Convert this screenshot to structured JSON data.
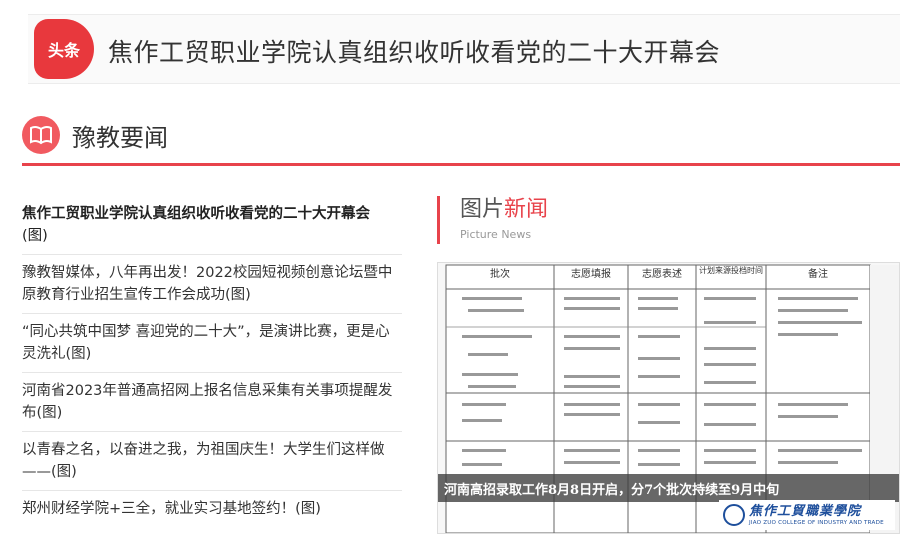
{
  "headline": {
    "badge": "头条",
    "title": "焦作工贸职业学院认真组织收听收看党的二十大开幕会"
  },
  "section": {
    "title": "豫教要闻"
  },
  "news": [
    {
      "title": "焦作工贸职业学院认真组织收听收看党的二十大开幕会",
      "tag": "(图)"
    },
    {
      "title": "豫教智媒体，八年再出发！2022校园短视频创意论坛暨中原教育行业招生宣传工作会成功(图)"
    },
    {
      "title": "“同心共筑中国梦 喜迎党的二十大”，是演讲比赛，更是心灵洗礼(图)"
    },
    {
      "title": "河南省2023年普通高招网上报名信息采集有关事项提醒发布(图)"
    },
    {
      "title": "以青春之名，以奋进之我，为祖国庆生！大学生们这样做——(图)"
    },
    {
      "title": "郑州财经学院+三全，就业实习基地签约！(图)"
    }
  ],
  "picture_news": {
    "title_a": "图片",
    "title_b": "新闻",
    "subtitle": "Picture News",
    "caption": "河南高招录取工作8月8日开启，分7个批次持续至9月中旬",
    "table_headers": [
      "批次",
      "志愿填报",
      "志愿表述",
      "计划来源投档时间",
      "备注"
    ],
    "logo_cn": "焦作工貿職業學院",
    "logo_en": "JIAO ZUO COLLEGE OF INDUSTRY AND TRADE"
  },
  "colors": {
    "accent": "#e8434b",
    "badge": "#e8383d",
    "logo_blue": "#1e4f9c"
  }
}
